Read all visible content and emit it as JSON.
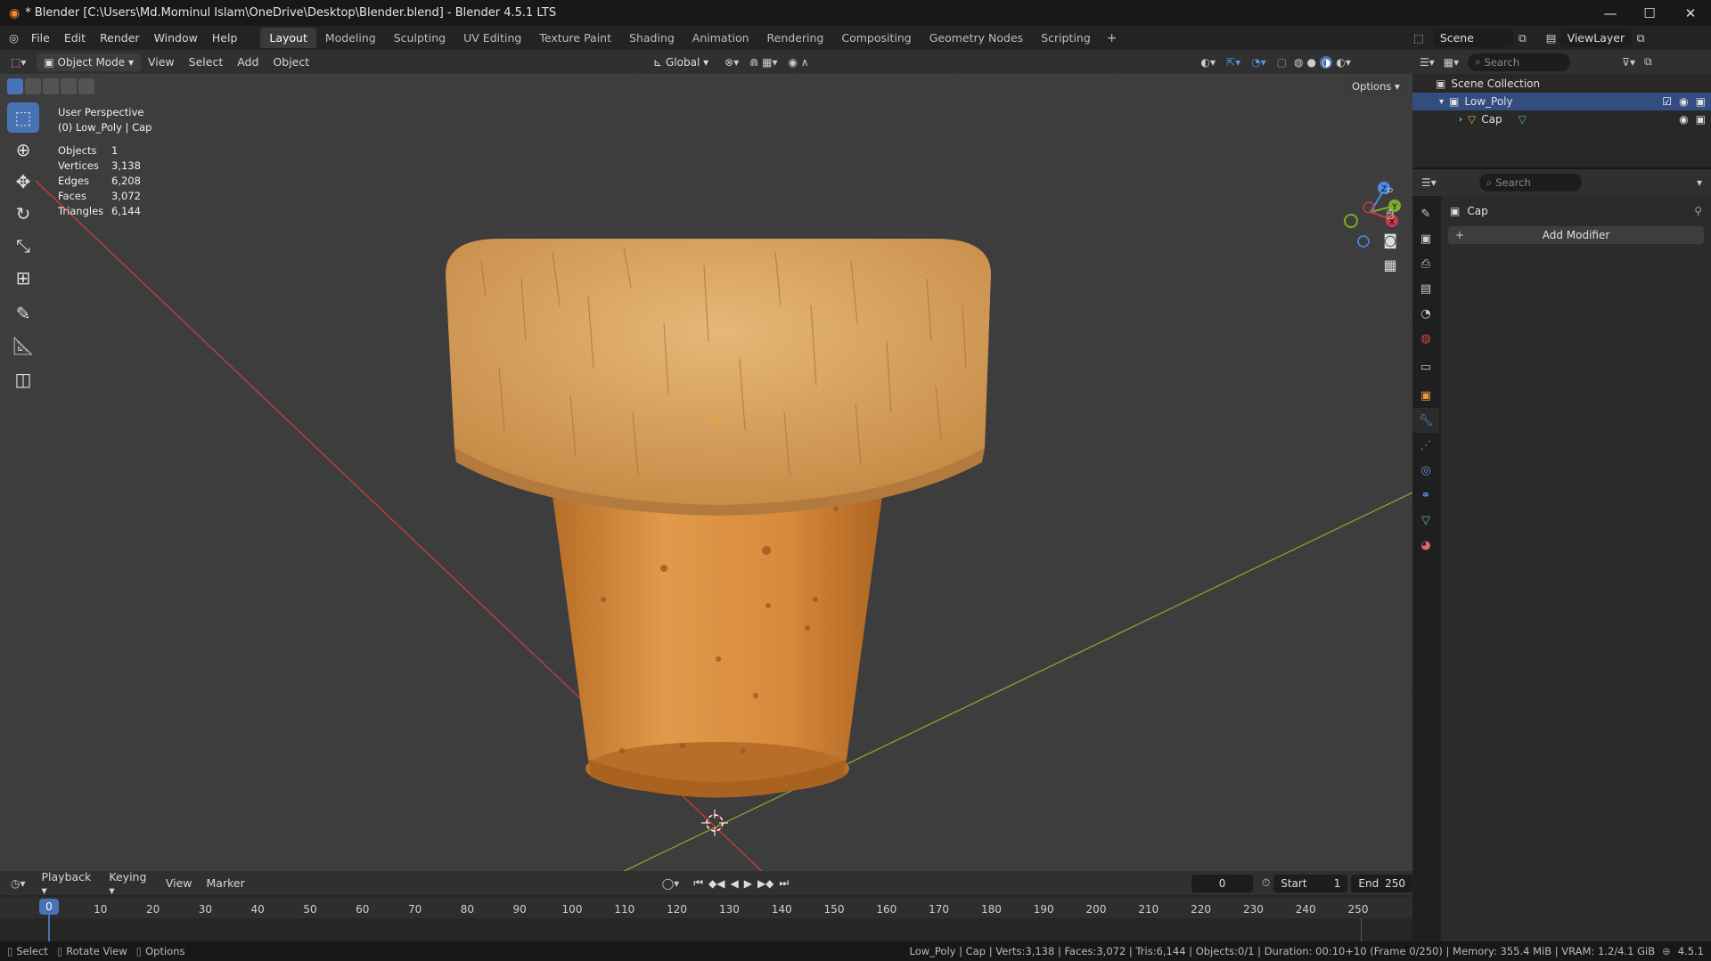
{
  "window": {
    "title": "* Blender [C:\\Users\\Md.Mominul Islam\\OneDrive\\Desktop\\Blender.blend] - Blender 4.5.1 LTS"
  },
  "menu": [
    "File",
    "Edit",
    "Render",
    "Window",
    "Help"
  ],
  "workspaces": [
    "Layout",
    "Modeling",
    "Sculpting",
    "UV Editing",
    "Texture Paint",
    "Shading",
    "Animation",
    "Rendering",
    "Compositing",
    "Geometry Nodes",
    "Scripting"
  ],
  "active_workspace": "Layout",
  "scene": {
    "label": "Scene",
    "view_layer": "ViewLayer"
  },
  "viewport_header": {
    "mode": "Object Mode",
    "menus": [
      "View",
      "Select",
      "Add",
      "Object"
    ],
    "orientation": "Global",
    "options": "Options"
  },
  "viewport_overlay": {
    "perspective": "User Perspective",
    "context": "(0) Low_Poly | Cap",
    "stats": [
      {
        "k": "Objects",
        "v": "1"
      },
      {
        "k": "Vertices",
        "v": "3,138"
      },
      {
        "k": "Edges",
        "v": "6,208"
      },
      {
        "k": "Faces",
        "v": "3,072"
      },
      {
        "k": "Triangles",
        "v": "6,144"
      }
    ]
  },
  "outliner": {
    "search_placeholder": "Search",
    "root": "Scene Collection",
    "collection": "Low_Poly",
    "object": "Cap"
  },
  "properties": {
    "search_placeholder": "Search",
    "object_name": "Cap",
    "add_modifier": "Add Modifier"
  },
  "timeline": {
    "menus": [
      "Playback",
      "Keying",
      "View",
      "Marker"
    ],
    "current_frame": "0",
    "start_label": "Start",
    "start": "1",
    "end_label": "End",
    "end": "250",
    "ticks": [
      "0",
      "10",
      "20",
      "30",
      "40",
      "50",
      "60",
      "70",
      "80",
      "90",
      "100",
      "110",
      "120",
      "130",
      "140",
      "150",
      "160",
      "170",
      "180",
      "190",
      "200",
      "210",
      "220",
      "230",
      "240",
      "250"
    ]
  },
  "statusbar": {
    "select": "Select",
    "rotate": "Rotate View",
    "options": "Options",
    "info": "Low_Poly | Cap | Verts:3,138 | Faces:3,072 | Tris:6,144 | Objects:0/1 | Duration: 00:10+10 (Frame 0/250) | Memory: 355.4 MiB | VRAM: 1.2/4.1 GiB",
    "version": "4.5.1"
  },
  "colors": {
    "accent": "#4772b3",
    "x_axis": "#c83c45",
    "y_axis": "#7cab2b",
    "cork_top": "#d9a566",
    "cork_body": "#d8893c"
  }
}
